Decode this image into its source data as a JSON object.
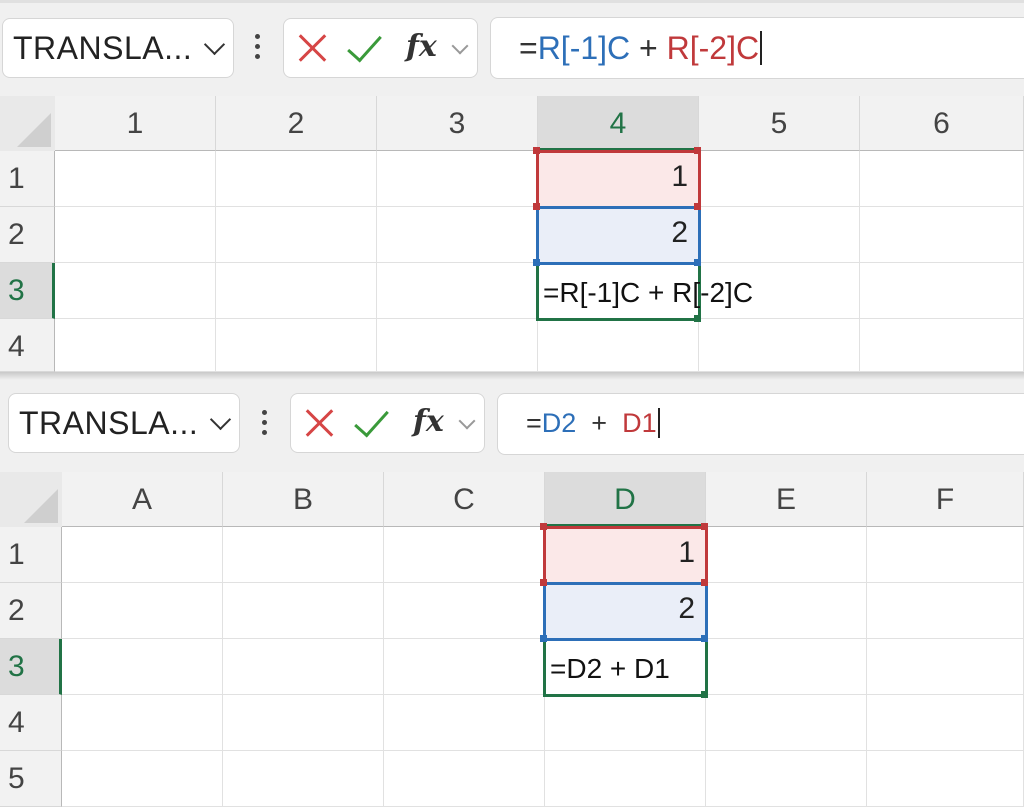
{
  "panels": [
    {
      "name_box": "TRANSLA...",
      "formula": {
        "prefix": "=",
        "ref1": "R[-1]C",
        "mid": " + ",
        "ref2": "R[-2]C"
      },
      "columns": [
        "1",
        "2",
        "3",
        "4",
        "5",
        "6"
      ],
      "rows": [
        "1",
        "2",
        "3",
        "4"
      ],
      "cells": {
        "r1": "1",
        "r2": "2",
        "r3": "=R[-1]C + R[-2]C"
      }
    },
    {
      "name_box": "TRANSLA...",
      "formula": {
        "prefix": "=",
        "ref1": "D2",
        "mid": "  +  ",
        "ref2": "D1"
      },
      "columns": [
        "A",
        "B",
        "C",
        "D",
        "E",
        "F"
      ],
      "rows": [
        "1",
        "2",
        "3",
        "4",
        "5"
      ],
      "cells": {
        "r1": "1",
        "r2": "2",
        "r3": "=D2 + D1"
      }
    }
  ],
  "colors": {
    "ref_blue": "#2d6fb8",
    "ref_red": "#c0393b",
    "active_green": "#217346"
  },
  "icons": [
    "chevron-down-icon",
    "more-options-icon",
    "cancel-x-icon",
    "enter-check-icon",
    "fx-icon"
  ]
}
